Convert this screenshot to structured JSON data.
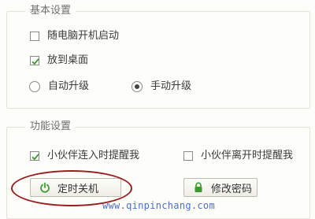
{
  "basic_settings": {
    "title": "基本设置",
    "auto_start": {
      "label": "随电脑开机启动",
      "checked": false
    },
    "desktop": {
      "label": "放到桌面",
      "checked": true
    },
    "upgrade_auto": {
      "label": "自动升级",
      "selected": false
    },
    "upgrade_manual": {
      "label": "手动升级",
      "selected": true
    }
  },
  "function_settings": {
    "title": "功能设置",
    "notify_join": {
      "label": "小伙伴连入时提醒我",
      "checked": true
    },
    "notify_leave": {
      "label": "小伙伴离开时提醒我",
      "checked": false
    },
    "shutdown_button": {
      "label": "定时关机",
      "icon": "power-icon"
    },
    "password_button": {
      "label": "修改密码",
      "icon": "lock-icon"
    }
  },
  "colors": {
    "accent_green": "#3c9a2c",
    "highlight_ellipse": "#9b1c1c",
    "watermark_blue": "#2f55c8"
  },
  "watermark": "www.qinpinchang.com"
}
